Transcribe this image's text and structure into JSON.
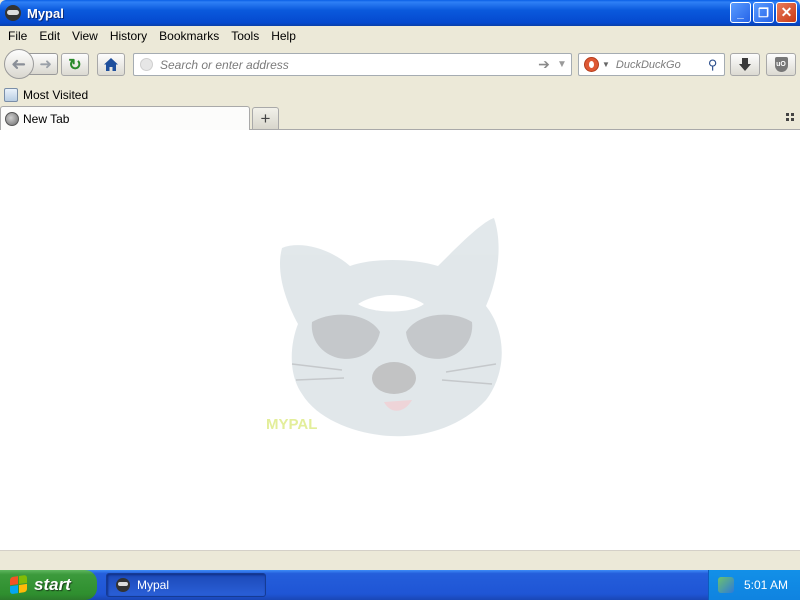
{
  "window": {
    "title": "Mypal"
  },
  "window_buttons": {
    "minimize": "_",
    "maximize": "❐",
    "close": "✕"
  },
  "menu": {
    "items": [
      "File",
      "Edit",
      "View",
      "History",
      "Bookmarks",
      "Tools",
      "Help"
    ]
  },
  "navbar": {
    "back_icon": "back-arrow-icon",
    "forward_icon": "forward-arrow-icon",
    "reload_icon": "reload-icon",
    "home_icon": "home-icon",
    "address_placeholder": "Search or enter address",
    "address_value": "",
    "search_engine": "DuckDuckGo",
    "search_placeholder": "DuckDuckGo",
    "download_icon": "download-arrow-icon",
    "addon_icon": "ublock-origin-icon",
    "addon_label": "uO"
  },
  "bookmarks": {
    "items": [
      {
        "label": "Most Visited",
        "icon": "bookmark-folder-icon"
      }
    ]
  },
  "tabs": {
    "items": [
      {
        "label": "New Tab",
        "active": true,
        "icon": "globe-icon"
      }
    ],
    "new_tab_label": "+"
  },
  "content": {
    "logo_text": "MYPAL"
  },
  "taskbar": {
    "start_label": "start",
    "tasks": [
      {
        "label": "Mypal",
        "active": true
      }
    ],
    "clock": "5:01 AM"
  },
  "colors": {
    "titlebar": "#0a59dc",
    "taskbar": "#245edb",
    "start_button": "#3c9a3c",
    "page_background": "#ffffff",
    "chrome": "#ece9d8"
  }
}
